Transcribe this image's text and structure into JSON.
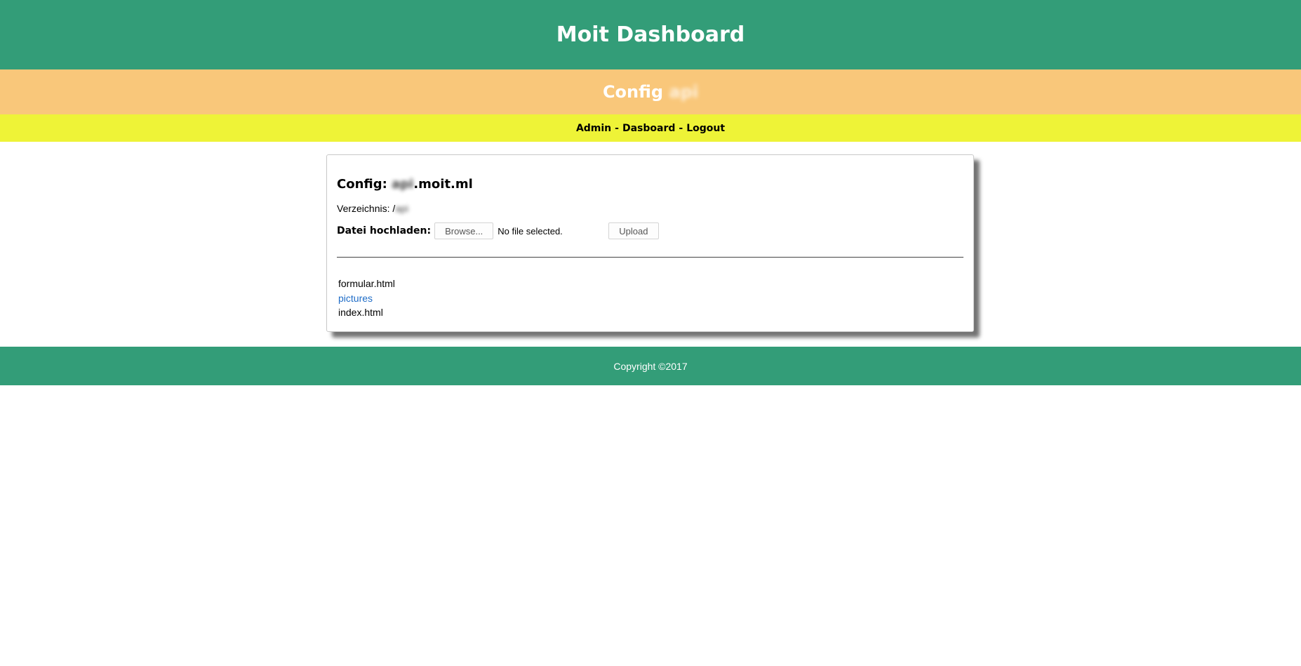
{
  "header": {
    "title": "Moit Dashboard"
  },
  "subheader": {
    "prefix": "Config",
    "name": "api"
  },
  "nav": {
    "admin": "Admin",
    "separator": "-",
    "dashboard": "Dasboard",
    "logout": "Logout"
  },
  "panel": {
    "title_prefix": "Config:",
    "title_subdomain": "api",
    "title_domain": ".moit.ml",
    "directory_label": "Verzeichnis:",
    "directory_slash": "/",
    "directory_name": "api",
    "upload_label": "Datei hochladen:",
    "browse_label": "Browse...",
    "file_status": "No file selected.",
    "upload_button": "Upload",
    "files": [
      {
        "name": "formular.html",
        "type": "file"
      },
      {
        "name": "pictures",
        "type": "folder"
      },
      {
        "name": "index.html",
        "type": "file"
      }
    ]
  },
  "footer": {
    "copyright": "Copyright ©2017"
  },
  "colors": {
    "header_bg": "#339d78",
    "subheader_bg": "#f9c77a",
    "nav_bg": "#eef337",
    "link": "#1e6cc7"
  }
}
